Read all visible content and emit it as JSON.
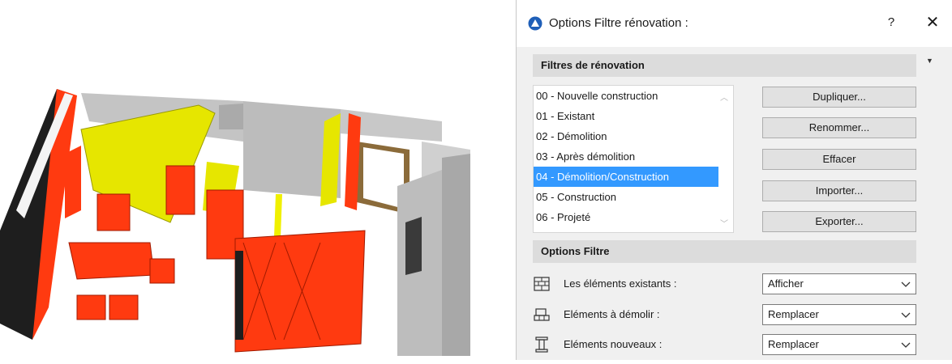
{
  "dialog": {
    "title": "Options Filtre rénovation :",
    "help_label": "?",
    "close_label": "✕"
  },
  "filters_section": {
    "header": "Filtres de rénovation",
    "items": [
      {
        "label": "00 - Nouvelle construction",
        "selected": false
      },
      {
        "label": "01 - Existant",
        "selected": false
      },
      {
        "label": "02 - Démolition",
        "selected": false
      },
      {
        "label": "03 - Après démolition",
        "selected": false
      },
      {
        "label": "04 - Démolition/Construction",
        "selected": true
      },
      {
        "label": "05 - Construction",
        "selected": false
      },
      {
        "label": "06 - Projeté",
        "selected": false
      }
    ],
    "buttons": {
      "duplicate": "Dupliquer...",
      "rename": "Renommer...",
      "delete": "Effacer",
      "import": "Importer...",
      "export": "Exporter..."
    }
  },
  "options_section": {
    "header": "Options Filtre",
    "rows": [
      {
        "label": "Les éléments existants :",
        "value": "Afficher",
        "icon": "brick-wall-icon"
      },
      {
        "label": "Eléments à démolir :",
        "value": "Remplacer",
        "icon": "demolish-icon"
      },
      {
        "label": "Eléments nouveaux :",
        "value": "Remplacer",
        "icon": "column-icon"
      }
    ]
  },
  "colors": {
    "selection": "#3399ff",
    "demolition_red": "#ff3a10",
    "new_yellow": "#e6e600",
    "existing_gray": "#b8b8b8"
  }
}
